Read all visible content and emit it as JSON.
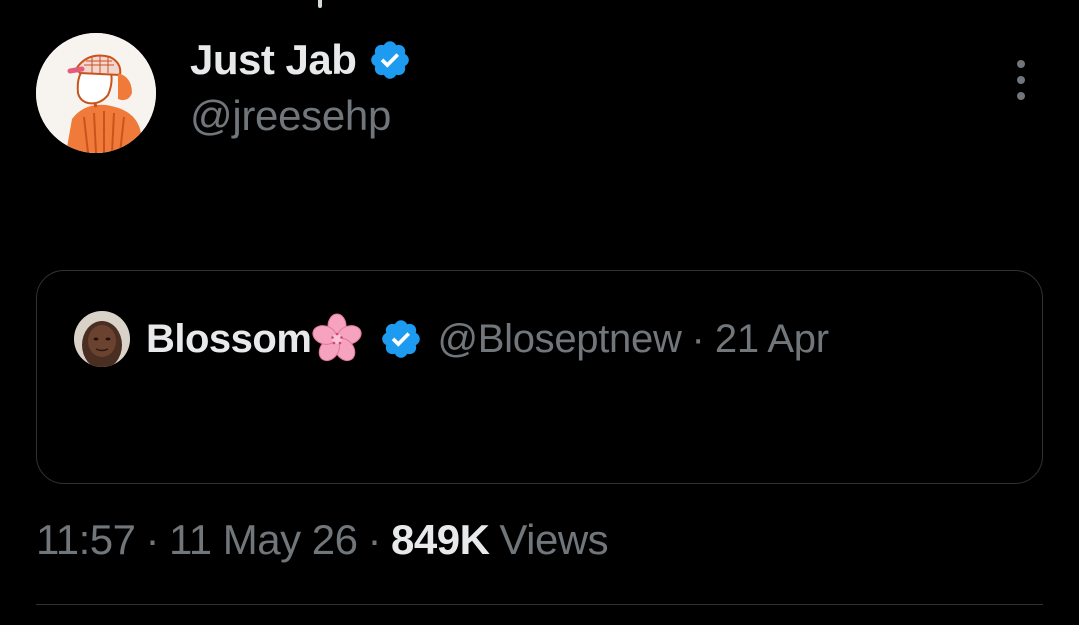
{
  "tweet": {
    "author": {
      "display_name": "Just Jab",
      "handle": "@jreesehp",
      "verified_icon": "verified-badge-icon",
      "avatar_icon": "illustrated-avatar"
    },
    "menu_icon": "more-vertical-icon",
    "quoted": {
      "display_name": "Blossom",
      "emoji_icon": "cherry-blossom-icon",
      "verified_icon": "verified-badge-icon",
      "handle": "@Bloseptnew",
      "separator": "·",
      "date": "21 Apr"
    },
    "meta": {
      "time": "11:57",
      "separator": "·",
      "date": "11 May 26",
      "views_count": "849K",
      "views_label": "Views"
    }
  },
  "colors": {
    "background": "#000000",
    "primary_text": "#e7e9ea",
    "secondary_text": "#71767b",
    "border": "#2f3336",
    "verified_blue": "#1d9bf0"
  }
}
